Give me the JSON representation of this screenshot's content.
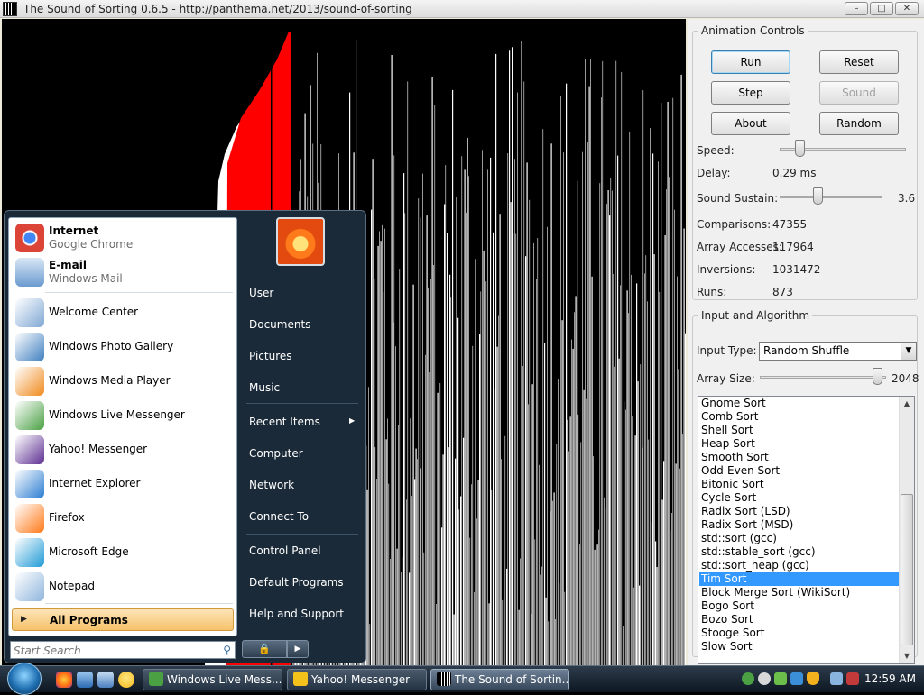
{
  "window": {
    "title": "The Sound of Sorting 0.6.5 - http://panthema.net/2013/sound-of-sorting",
    "min_glyph": "–",
    "max_glyph": "□",
    "close_glyph": "✕"
  },
  "visualization": {
    "colors": {
      "background": "#000000",
      "bar": "#ffffff",
      "highlight": "#ff0000",
      "marker": "#000000"
    }
  },
  "animation_controls": {
    "legend": "Animation Controls",
    "run_label": "Run",
    "reset_label": "Reset",
    "step_label": "Step",
    "sound_label": "Sound",
    "about_label": "About",
    "random_label": "Random",
    "speed_label": "Speed:",
    "speed_fraction": 0.13,
    "delay_label": "Delay:",
    "delay_value": "0.29 ms",
    "sustain_label": "Sound Sustain:",
    "sustain_fraction": 0.36,
    "sustain_value": "3.6",
    "comparisons_label": "Comparisons:",
    "comparisons_value": "47355",
    "array_accesses_label": "Array Accesses:",
    "array_accesses_value": "117964",
    "inversions_label": "Inversions:",
    "inversions_value": "1031472",
    "runs_label": "Runs:",
    "runs_value": "873"
  },
  "input_algorithm": {
    "legend": "Input and Algorithm",
    "input_type_label": "Input Type:",
    "input_type_value": "Random Shuffle",
    "array_size_label": "Array Size:",
    "array_size_fraction": 0.97,
    "array_size_value": "2048",
    "algorithms": [
      "Gnome Sort",
      "Comb Sort",
      "Shell Sort",
      "Heap Sort",
      "Smooth Sort",
      "Odd-Even Sort",
      "Bitonic Sort",
      "Cycle Sort",
      "Radix Sort (LSD)",
      "Radix Sort (MSD)",
      "std::sort (gcc)",
      "std::stable_sort (gcc)",
      "std::sort_heap (gcc)",
      "Tim Sort",
      "Block Merge Sort (WikiSort)",
      "Bogo Sort",
      "Bozo Sort",
      "Stooge Sort",
      "Slow Sort"
    ],
    "selected_algorithm": "Tim Sort"
  },
  "start_menu": {
    "pinned": [
      {
        "title": "Internet",
        "subtitle": "Google Chrome",
        "icon": "chrome-icon",
        "color": "#db4437"
      },
      {
        "title": "E-mail",
        "subtitle": "Windows Mail",
        "icon": "mail-icon",
        "color": "#6a9ad0"
      }
    ],
    "recent": [
      {
        "label": "Welcome Center",
        "icon": "welcome-center-icon",
        "color": "#7fa7d4"
      },
      {
        "label": "Windows Photo Gallery",
        "icon": "photo-gallery-icon",
        "color": "#3f7fc0"
      },
      {
        "label": "Windows Media Player",
        "icon": "media-player-icon",
        "color": "#f08a1c"
      },
      {
        "label": "Windows Live Messenger",
        "icon": "live-messenger-icon",
        "color": "#4aa043"
      },
      {
        "label": "Yahoo! Messenger",
        "icon": "yahoo-messenger-icon",
        "color": "#5c2d91"
      },
      {
        "label": "Internet Explorer",
        "icon": "internet-explorer-icon",
        "color": "#2a7cd2"
      },
      {
        "label": "Firefox",
        "icon": "firefox-icon",
        "color": "#ff7a19"
      },
      {
        "label": "Microsoft Edge",
        "icon": "edge-icon",
        "color": "#1f9ad6"
      },
      {
        "label": "Notepad",
        "icon": "notepad-icon",
        "color": "#8fb5dd"
      }
    ],
    "all_programs_label": "All Programs",
    "search_placeholder": "Start Search",
    "right_items": [
      "User",
      "Documents",
      "Pictures",
      "Music",
      "Recent Items",
      "Computer",
      "Network",
      "Connect To",
      "Control Panel",
      "Default Programs",
      "Help and Support"
    ],
    "power_glyph": "🔒",
    "power_arrow_glyph": "▶"
  },
  "taskbar": {
    "buttons": [
      {
        "label": "Windows Live Mess...",
        "icon": "live-messenger-icon",
        "color": "#4aa043"
      },
      {
        "label": "Yahoo! Messenger",
        "icon": "yahoo-messenger-icon",
        "color": "#f3c21b"
      },
      {
        "label": "The Sound of Sortin...",
        "icon": "sound-of-sorting-icon",
        "color": "#ffffff"
      }
    ],
    "quick_launch": [
      "firefox-icon",
      "show-desktop-icon",
      "switch-windows-icon",
      "yahoo-icon"
    ],
    "clock": "12:59 AM"
  }
}
